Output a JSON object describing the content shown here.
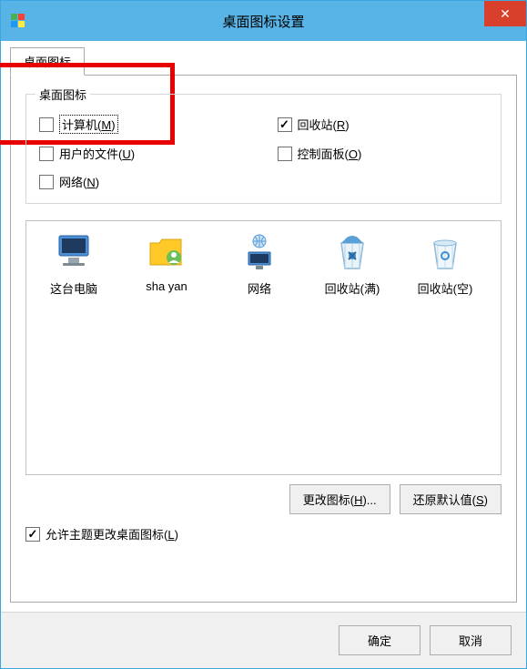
{
  "window": {
    "title": "桌面图标设置"
  },
  "tab": {
    "label": "桌面图标"
  },
  "group": {
    "title": "桌面图标",
    "checkboxes": {
      "computer": {
        "label": "计算机(",
        "hotkey": "M",
        "suffix": ")",
        "checked": false
      },
      "recycleBin": {
        "label": "回收站(",
        "hotkey": "R",
        "suffix": ")",
        "checked": true
      },
      "userFiles": {
        "label": "用户的文件(",
        "hotkey": "U",
        "suffix": ")",
        "checked": false
      },
      "controlPanel": {
        "label": "控制面板(",
        "hotkey": "O",
        "suffix": ")",
        "checked": false
      },
      "network": {
        "label": "网络(",
        "hotkey": "N",
        "suffix": ")",
        "checked": false
      }
    }
  },
  "iconList": [
    {
      "label": "这台电脑",
      "semantic": "computer-icon"
    },
    {
      "label": "sha yan",
      "semantic": "user-folder-icon"
    },
    {
      "label": "网络",
      "semantic": "network-icon"
    },
    {
      "label": "回收站(满)",
      "semantic": "recycle-full-icon"
    },
    {
      "label": "回收站(空)",
      "semantic": "recycle-empty-icon"
    }
  ],
  "buttons": {
    "changeIcon": "更改图标(",
    "changeIconHotkey": "H",
    "changeIconSuffix": ")...",
    "restoreDefault": "还原默认值(",
    "restoreDefaultHotkey": "S",
    "restoreDefaultSuffix": ")"
  },
  "allowTheme": {
    "label": "允许主题更改桌面图标(",
    "hotkey": "L",
    "suffix": ")",
    "checked": true
  },
  "dialog": {
    "ok": "确定",
    "cancel": "取消"
  }
}
